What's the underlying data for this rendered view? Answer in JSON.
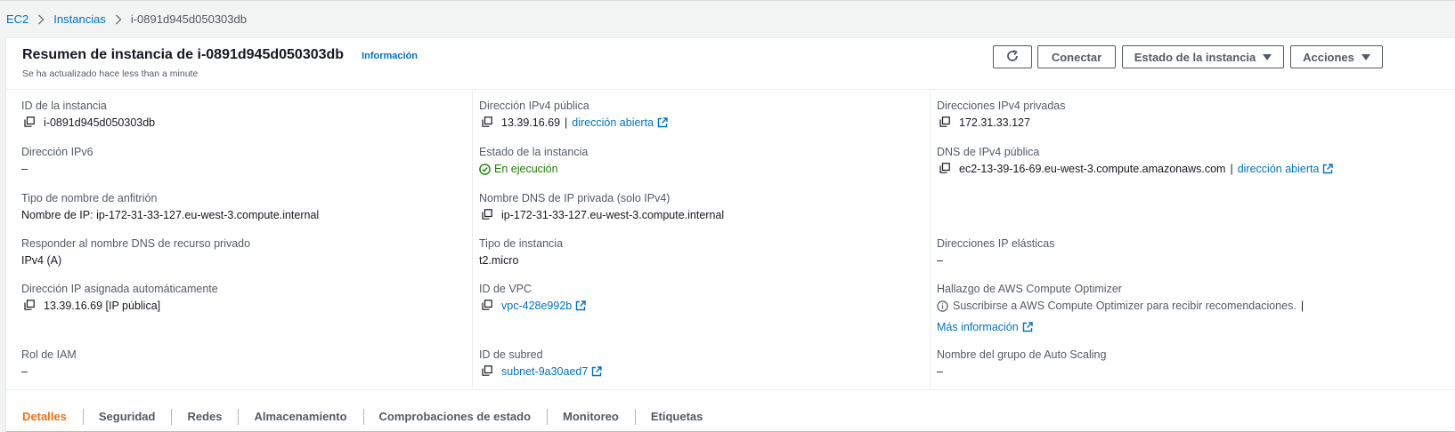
{
  "breadcrumb": {
    "items": [
      {
        "label": "EC2"
      },
      {
        "label": "Instancias"
      }
    ],
    "current": "i-0891d945d050303db"
  },
  "header": {
    "title": "Resumen de instancia de i-0891d945d050303db",
    "info_link": "Información",
    "subtitle": "Se ha actualizado hace less than a minute",
    "buttons": {
      "refresh_icon": "refresh-icon",
      "connect": "Conectar",
      "instance_state": "Estado de la instancia",
      "actions": "Acciones"
    }
  },
  "details": {
    "instance_id": {
      "label": "ID de la instancia",
      "value": "i-0891d945d050303db"
    },
    "ipv6": {
      "label": "Dirección IPv6",
      "value": "–"
    },
    "hostname_type": {
      "label": "Tipo de nombre de anfitrión",
      "value": "Nombre de IP: ip-172-31-33-127.eu-west-3.compute.internal"
    },
    "resource_dns": {
      "label": "Responder al nombre DNS de recurso privado",
      "value": "IPv4 (A)"
    },
    "auto_ip": {
      "label": "Dirección IP asignada automáticamente",
      "value": "13.39.16.69 [IP pública]"
    },
    "iam_role": {
      "label": "Rol de IAM",
      "value": "–"
    },
    "public_ipv4": {
      "label": "Dirección IPv4 pública",
      "value": "13.39.16.69",
      "link": "dirección abierta"
    },
    "instance_state": {
      "label": "Estado de la instancia",
      "value": "En ejecución"
    },
    "private_dns": {
      "label": "Nombre DNS de IP privada (solo IPv4)",
      "value": "ip-172-31-33-127.eu-west-3.compute.internal"
    },
    "instance_type": {
      "label": "Tipo de instancia",
      "value": "t2.micro"
    },
    "vpc_id": {
      "label": "ID de VPC",
      "value": "vpc-428e992b"
    },
    "subnet_id": {
      "label": "ID de subred",
      "value": "subnet-9a30aed7"
    },
    "private_ipv4": {
      "label": "Direcciones IPv4 privadas",
      "value": "172.31.33.127"
    },
    "public_dns": {
      "label": "DNS de IPv4 pública",
      "value": "ec2-13-39-16-69.eu-west-3.compute.amazonaws.com",
      "link": "dirección abierta"
    },
    "elastic_ip": {
      "label": "Direcciones IP elásticas",
      "value": "–"
    },
    "optimizer": {
      "label": "Hallazgo de AWS Compute Optimizer",
      "value": "Suscribirse a AWS Compute Optimizer para recibir recomendaciones.",
      "link": "Más información"
    },
    "asg": {
      "label": "Nombre del grupo de Auto Scaling",
      "value": "–"
    }
  },
  "tabs": [
    "Detalles",
    "Seguridad",
    "Redes",
    "Almacenamiento",
    "Comprobaciones de estado",
    "Monitoreo",
    "Etiquetas"
  ],
  "colors": {
    "link": "#0073bb",
    "running": "#1d8102",
    "active_tab": "#ec7211"
  }
}
